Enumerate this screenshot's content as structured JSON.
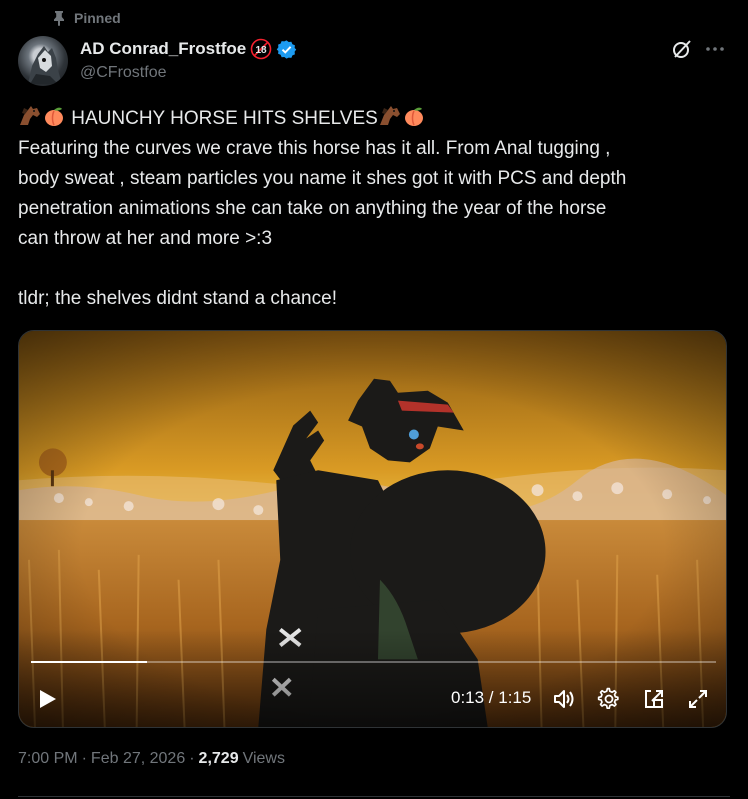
{
  "pinned": {
    "label": "Pinned"
  },
  "author": {
    "display_name": "AD Conrad_Frostfoe",
    "handle": "@CFrostfoe",
    "age_badge": "18",
    "verified": true
  },
  "tweet": {
    "headline": "HAUNCHY HORSE HITS SHELVES",
    "headline_emoji_left": [
      "horse-emoji",
      "peach-emoji"
    ],
    "headline_emoji_right": [
      "horse-emoji",
      "peach-emoji"
    ],
    "body_lines": [
      "Featuring the curves we crave this horse has it all. From  Anal tugging ,",
      "body sweat , steam particles you name it shes got it with PCS and depth",
      "penetration animations she can take on anything the year of the horse",
      "can throw at her and more >:3"
    ],
    "tldr": "tldr; the shelves didnt stand a chance!"
  },
  "video": {
    "current_time": "0:13",
    "duration": "1:15",
    "time_display": "0:13 / 1:15",
    "progress": 0.17
  },
  "meta": {
    "time": "7:00 PM",
    "date": "Feb 27, 2026",
    "views_count": "2,729",
    "views_label": "Views"
  },
  "colors": {
    "background": "#000000",
    "text_primary": "#e7e9ea",
    "text_secondary": "#71767b",
    "verified_blue": "#1d9bf0",
    "age_badge_red": "#f4212e"
  }
}
